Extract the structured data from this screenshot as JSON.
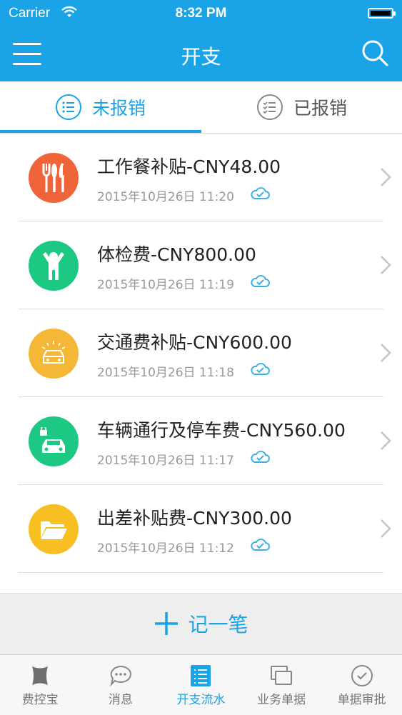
{
  "status_bar": {
    "carrier": "Carrier",
    "time": "8:32 PM"
  },
  "nav": {
    "title": "开支",
    "menu_icon": "hamburger-icon",
    "search_icon": "search-icon"
  },
  "tabs": [
    {
      "label": "未报销",
      "active": true
    },
    {
      "label": "已报销",
      "active": false
    }
  ],
  "expenses": [
    {
      "title": "工作餐补贴-CNY48.00",
      "date": "2015年10月26日 11:20",
      "icon": "fork-knife-icon",
      "color": "#f0643a"
    },
    {
      "title": "体检费-CNY800.00",
      "date": "2015年10月26日 11:19",
      "icon": "person-icon",
      "color": "#1dc882"
    },
    {
      "title": "交通费补贴-CNY600.00",
      "date": "2015年10月26日 11:18",
      "icon": "car-icon",
      "color": "#f5b836"
    },
    {
      "title": "车辆通行及停车费-CNY560.00",
      "date": "2015年10月26日 11:17",
      "icon": "parking-car-icon",
      "color": "#1dc882"
    },
    {
      "title": "出差补贴费-CNY300.00",
      "date": "2015年10月26日 11:12",
      "icon": "folder-icon",
      "color": "#f7bf22"
    }
  ],
  "add_button": {
    "label": "记一笔"
  },
  "tab_bar": [
    {
      "label": "费控宝",
      "icon": "app-logo-icon"
    },
    {
      "label": "消息",
      "icon": "chat-bubble-icon"
    },
    {
      "label": "开支流水",
      "icon": "list-icon",
      "active": true
    },
    {
      "label": "业务单据",
      "icon": "documents-icon"
    },
    {
      "label": "单据审批",
      "icon": "check-circle-icon"
    }
  ],
  "colors": {
    "accent": "#1aa3e6"
  }
}
